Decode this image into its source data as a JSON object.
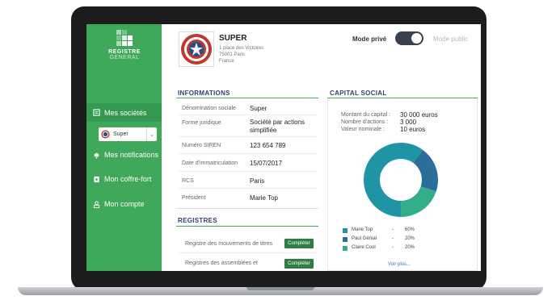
{
  "app": {
    "logo_line1": "REGISTRE",
    "logo_line2": "GENERAL"
  },
  "sidebar": {
    "items": [
      {
        "label": "Mes sociétés",
        "icon": "folder-icon",
        "active": true
      },
      {
        "label": "Mes notifications",
        "icon": "bell-icon",
        "active": false
      },
      {
        "label": "Mon coffre-fort",
        "icon": "safe-icon",
        "active": false
      },
      {
        "label": "Mon compte",
        "icon": "user-icon",
        "active": false
      }
    ],
    "company_select": {
      "value": "Super"
    }
  },
  "header": {
    "company_name": "SUPER",
    "address": [
      "1 place des Victoires",
      "75001 Paris",
      "France"
    ],
    "mode_private": "Mode privé",
    "mode_public": "Mode public"
  },
  "informations": {
    "title": "INFORMATIONS",
    "rows": [
      {
        "label": "Dénomination sociale",
        "value": "Super"
      },
      {
        "label": "Forme juridique",
        "value": "Société par actions simplifiée"
      },
      {
        "label": "Numéro SIREN",
        "value": "123 654 789"
      },
      {
        "label": "Date d'immatriculation",
        "value": "15/07/2017"
      },
      {
        "label": "RCS",
        "value": "Paris"
      },
      {
        "label": "Président",
        "value": "Marie Top"
      }
    ]
  },
  "registres": {
    "title": "REGISTRES",
    "rows": [
      {
        "label": "Registre des mouvements de titres",
        "button": "Compléter"
      },
      {
        "label": "Registres des assemblées et",
        "button": "Compléter"
      }
    ]
  },
  "capital": {
    "title": "CAPITAL SOCIAL",
    "rows": [
      {
        "label": "Montant du capital :",
        "value": "30 000 euros"
      },
      {
        "label": "Nombre d'actions :",
        "value": "3 000"
      },
      {
        "label": "Valeur nominale :",
        "value": "10 euros"
      }
    ],
    "see_more": "Voir plus..."
  },
  "colors": {
    "green": "#3fa85b",
    "teal": "#1f94a4",
    "blue": "#2c6e9a",
    "mint": "#34ae8a"
  },
  "chart_data": {
    "type": "pie",
    "categories": [
      "Marie Top",
      "Paul Génial",
      "Claire Cool"
    ],
    "values": [
      60,
      20,
      20
    ],
    "value_labels": [
      "60%",
      "20%",
      "20%"
    ],
    "separator": "-",
    "colors": [
      "#1f94a4",
      "#2c6e9a",
      "#34ae8a"
    ]
  }
}
